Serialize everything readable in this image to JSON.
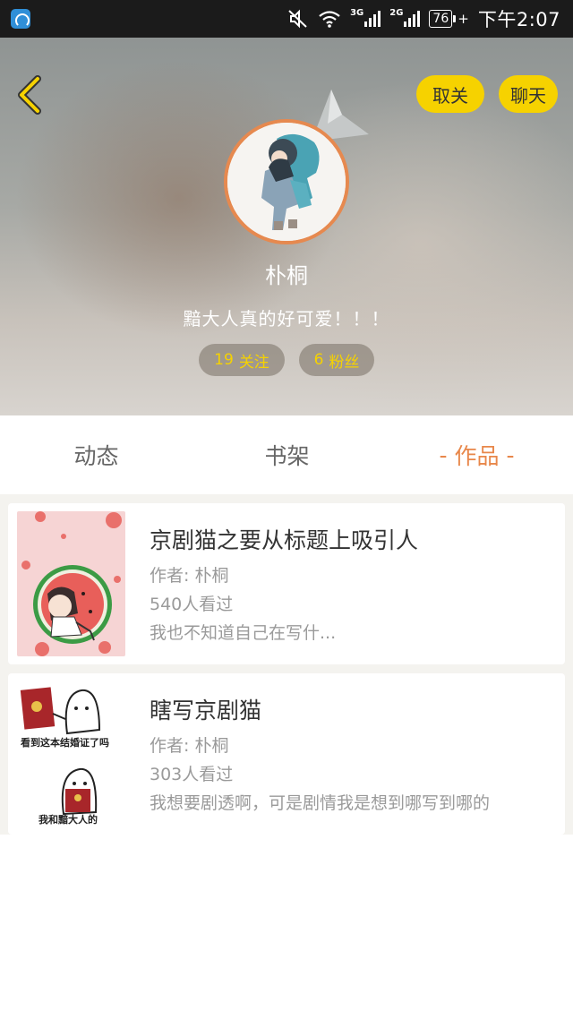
{
  "status_bar": {
    "net1": "3G",
    "net2": "2G",
    "battery": "76",
    "time": "下午2:07",
    "icons": [
      "app-icon",
      "mute-icon",
      "wifi-icon",
      "signal-icon",
      "battery-icon"
    ]
  },
  "header": {
    "unfollow_label": "取关",
    "chat_label": "聊天",
    "accent_color": "#f6d200"
  },
  "profile": {
    "name": "朴桐",
    "bio": "黯大人真的好可爱！！！",
    "following_count": "19",
    "following_label": "关注",
    "fans_count": "6",
    "fans_label": "粉丝"
  },
  "tabs": {
    "items": [
      {
        "label": "动态"
      },
      {
        "label": "书架"
      },
      {
        "label": "作品"
      }
    ],
    "active_dash": "-",
    "active_color": "#e8874a"
  },
  "works": [
    {
      "title": "京剧猫之要从标题上吸引人",
      "author": "作者: 朴桐",
      "views": "540人看过",
      "desc": "我也不知道自己在写什..."
    },
    {
      "title": "瞎写京剧猫",
      "author": "作者: 朴桐",
      "views": "303人看过",
      "desc": "我想要剧透啊，可是剧情我是想到哪写到哪的",
      "cover_caption_top": "看到这本结婚证了吗",
      "cover_caption_bottom": "我和黯大人的"
    }
  ]
}
